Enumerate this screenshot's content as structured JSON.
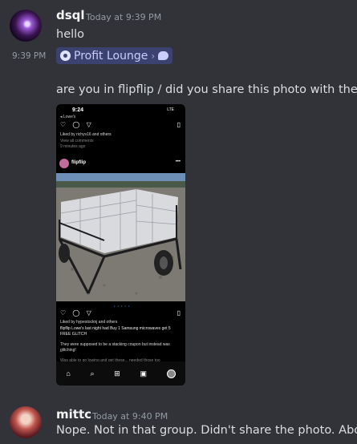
{
  "messages": [
    {
      "username": "dsql",
      "timestamp": "Today at 9:39 PM",
      "text": "hello",
      "side_time": "9:39 PM",
      "channel_mention": "Profit Lounge",
      "followup_text": "are you in flipflip / did you share this photo with them"
    },
    {
      "username": "mittc",
      "timestamp": "Today at 9:40 PM",
      "text": "Nope. Not in that group. Didn't share the photo. About t"
    }
  ],
  "attachment": {
    "status_time": "9:24",
    "status_right": "LTE",
    "back_label": "◂ Lowe's",
    "liked_top": "Liked by richyv16 and others",
    "view_all": "View all comments",
    "ago": "9 minutes ago",
    "handle": "flipflip",
    "liked_bottom": "Liked by hypestocknj and others",
    "caption": "flipflip Lowe's last night had Buy 1 Samsung microwaves get 5 FREE GLITCH",
    "caption2": "They were supposed to be a stacking coupon but instead was glitching!",
    "caption3": "Was able to go lowing and get these... needed those too"
  },
  "colors": {
    "background": "#313338",
    "channel_pill": "#3c4270",
    "username": "#f2f3f5",
    "muted": "#949ba4"
  }
}
